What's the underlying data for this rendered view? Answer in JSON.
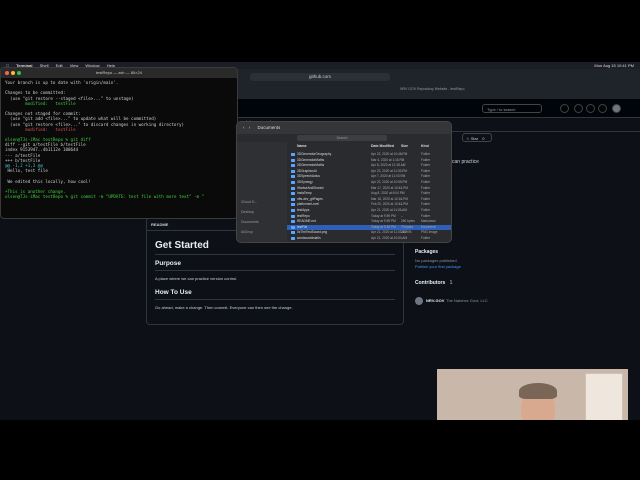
{
  "menubar": {
    "app": "Terminal",
    "items": [
      "Shell",
      "Edit",
      "View",
      "Window",
      "Help"
    ],
    "clock": "Mon Aug 15  10:41 PM"
  },
  "browser": {
    "url": "github.com",
    "tab_title": "NRV GOV Repository Website - testRepo"
  },
  "github": {
    "search_placeholder": "Type / to search",
    "nav_tabs": [
      "Insights",
      "Settings"
    ],
    "star_label": "Star",
    "star_count": "0",
    "about_fragment": "can practice",
    "readme": {
      "tab": "README",
      "title": "Get Started",
      "sections": [
        {
          "heading": "Purpose",
          "text": "A place where we can practice version control."
        },
        {
          "heading": "How To Use",
          "text": "Go ahead, make a change. Then commit. Everyone can then see the change."
        }
      ]
    },
    "sidebar": {
      "packages_heading": "Packages",
      "packages_none": "No packages published",
      "packages_link": "Publish your first package",
      "contributors_heading": "Contributors",
      "contributors_count": "1",
      "contributor_name": "NRV-GOV",
      "contributor_org": "The Natchez Govt, LLC"
    }
  },
  "terminal": {
    "title": "testRepo — zsh — 80×24",
    "lines": [
      {
        "t": "Your branch is up to date with 'origin/main'.",
        "c": "#d0d0d0"
      },
      {
        "t": "",
        "c": "#d0d0d0"
      },
      {
        "t": "Changes to be committed:",
        "c": "#d0d0d0"
      },
      {
        "t": "  (use \"git restore --staged <file>...\" to unstage)",
        "c": "#d0d0d0"
      },
      {
        "t": "        modified:   testFile",
        "c": "#3fd13f"
      },
      {
        "t": "",
        "c": "#d0d0d0"
      },
      {
        "t": "Changes not staged for commit:",
        "c": "#d0d0d0"
      },
      {
        "t": "  (use \"git add <file>...\" to update what will be committed)",
        "c": "#d0d0d0"
      },
      {
        "t": "  (use \"git restore <file>...\" to discard changes in working directory)",
        "c": "#d0d0d0"
      },
      {
        "t": "        modified:   testFile",
        "c": "#e05050"
      },
      {
        "t": "",
        "c": "#d0d0d0"
      },
      {
        "t": "olsen@TJs-iMac testRepo % git diff",
        "c": "#3fd13f"
      },
      {
        "t": "diff --git a/testFile b/testFile",
        "c": "#d0d0d0"
      },
      {
        "t": "index 9153947..4b1112e 100644",
        "c": "#d0d0d0"
      },
      {
        "t": "--- a/testFile",
        "c": "#d0d0d0"
      },
      {
        "t": "+++ b/testFile",
        "c": "#d0d0d0"
      },
      {
        "t": "@@ -1,2 +1,3 @@",
        "c": "#40c0d0"
      },
      {
        "t": " Hello, test file",
        "c": "#d0d0d0"
      },
      {
        "t": "",
        "c": "#d0d0d0"
      },
      {
        "t": " We edited this locally, how cool!",
        "c": "#d0d0d0"
      },
      {
        "t": "",
        "c": "#d0d0d0"
      },
      {
        "t": "+This is another change.",
        "c": "#3fd13f"
      },
      {
        "t": "olsen@TJs-iMac testRepo % git commit -m \"UPDATE: test file with more text\" -m \"",
        "c": "#3fd13f"
      }
    ]
  },
  "finder": {
    "title": "Documents",
    "search": "Search",
    "sidebar_items": [
      "iCloud D...",
      "Desktop",
      "Documents",
      "Ai/Drop"
    ],
    "columns": [
      "Name",
      "Date Modified",
      "Size",
      "Kind"
    ],
    "rows": [
      {
        "name": "3DGeneratorGeography",
        "date": "Apr 22, 2020 at 10:48 PM",
        "size": "--",
        "kind": "Folder"
      },
      {
        "name": "3DGeneratorMaths",
        "date": "Mar 4, 2020 at 1:16 PM",
        "size": "--",
        "kind": "Folder"
      },
      {
        "name": "3DGeneratorMaths",
        "date": "Apr 8, 2020 at 12:18 AM",
        "size": "--",
        "kind": "Folder"
      },
      {
        "name": "3DGraphicsUI",
        "date": "Apr 22, 2020 at 11:32 PM",
        "size": "--",
        "kind": "Folder"
      },
      {
        "name": "3DSpeechActus",
        "date": "Apr 7, 2020 at 11:03 PM",
        "size": "--",
        "kind": "Folder"
      },
      {
        "name": "3DSynergy",
        "date": "Apr 22, 2020 at 10:59 PM",
        "size": "--",
        "kind": "Folder"
      },
      {
        "name": "iHarborAndShared",
        "date": "Mar 17, 2020 at 10:43 PM",
        "size": "--",
        "kind": "Folder"
      },
      {
        "name": "InstaTemp",
        "date": "Aug 8, 2020 at 6:04 PM",
        "size": "--",
        "kind": "Folder"
      },
      {
        "name": "nfts-dev_ghPages",
        "date": "Mar 18, 2020 at 10:16 PM",
        "size": "--",
        "kind": "Folder"
      },
      {
        "name": "platformerLevel",
        "date": "Feb 20, 2020 at 10:43 PM",
        "size": "--",
        "kind": "Folder"
      },
      {
        "name": "testApps",
        "date": "Apr 21, 2020 at 11:26 AM",
        "size": "--",
        "kind": "Folder"
      },
      {
        "name": "testRepo",
        "date": "Today at 9:59 PM",
        "size": "--",
        "kind": "Folder"
      },
      {
        "name": "README.md",
        "date": "Today at 9:59 PM",
        "size": "260 bytes",
        "kind": "Markdown"
      },
      {
        "name": "testFile",
        "date": "Today at 9:39 PM",
        "size": "79 bytes",
        "kind": "Document"
      },
      {
        "name": "0sTheTestSound.png",
        "date": "Apr 21, 2020 at 11:03 AM",
        "size": "210 KB",
        "kind": "PNG image"
      },
      {
        "name": "wordsworldslatin",
        "date": "Apr 21, 2020 at 10:53 AM",
        "size": "--",
        "kind": "Folder"
      }
    ]
  },
  "dock": {
    "icons": [
      "finder-icon",
      "launchpad-icon",
      "safari-icon",
      "mail-icon",
      "facetime-icon",
      "photos-icon",
      "messages-icon",
      "maps-icon",
      "calendar-icon",
      "contacts-icon",
      "reminders-icon",
      "notes-icon",
      "tv-icon",
      "music-icon",
      "podcasts-icon",
      "news-icon",
      "numbers-icon",
      "keynote-icon",
      "pages-icon",
      "appstore-icon",
      "settings-icon",
      "scripteditor-icon",
      "terminal-icon",
      "preview-icon",
      "chrome-icon",
      "vscode-icon",
      "messenger-icon",
      "trash-icon"
    ],
    "colors": [
      "#3b8cf0",
      "#c0c0c8",
      "#2f8df5",
      "#3a7bf7",
      "#3fc75a",
      "#f2a23a",
      "#42c75c",
      "#5cba6a",
      "#ffffff",
      "#c79a6b",
      "#ffffff",
      "#f7d64a",
      "#1c1c1e",
      "#f94c63",
      "#9b52e0",
      "#f54545",
      "#3cb24a",
      "#2f7df5",
      "#f59c32",
      "#2f8df5",
      "#8e8e93",
      "#b0b0b5",
      "#2a2a2a",
      "#4aa3f0",
      "#dddddd",
      "#2d8ce0",
      "#a05ff0",
      "#c8c8cc"
    ]
  }
}
